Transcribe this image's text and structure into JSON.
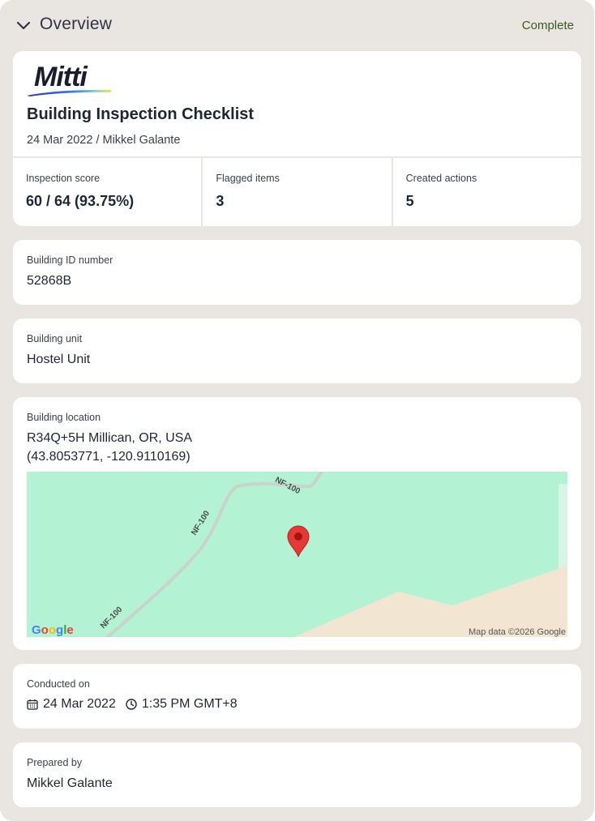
{
  "header": {
    "title": "Overview",
    "status": "Complete"
  },
  "summary": {
    "logo_text": "Mitti",
    "title": "Building Inspection Checklist",
    "subtitle": "24 Mar 2022 / Mikkel Galante",
    "stats": [
      {
        "label": "Inspection score",
        "value": "60 / 64 (93.75%)"
      },
      {
        "label": "Flagged items",
        "value": "3"
      },
      {
        "label": "Created actions",
        "value": "5"
      }
    ]
  },
  "fields": {
    "building_id": {
      "label": "Building ID number",
      "value": "52868B"
    },
    "building_unit": {
      "label": "Building unit",
      "value": "Hostel Unit"
    },
    "building_location": {
      "label": "Building location",
      "address": "R34Q+5H Millican, OR, USA",
      "coords": "(43.8053771, -120.9110169)"
    },
    "conducted_on": {
      "label": "Conducted on",
      "date": "24 Mar 2022",
      "time": "1:35 PM GMT+8"
    },
    "prepared_by": {
      "label": "Prepared by",
      "value": "Mikkel Galante"
    }
  },
  "map": {
    "road_labels": [
      "NF-100",
      "NF-100",
      "NF-100"
    ],
    "attribution": "Map data ©2026 Google",
    "google_logo": "Google"
  },
  "colors": {
    "panel_bg": "#e9e6e1",
    "status_text": "#3a5a1f",
    "map_green": "#b3f2d2",
    "map_sand": "#f2e6d3",
    "pin": "#e53935"
  },
  "icons": [
    "chevron-down-icon",
    "calendar-icon",
    "clock-icon",
    "map-pin-icon"
  ]
}
